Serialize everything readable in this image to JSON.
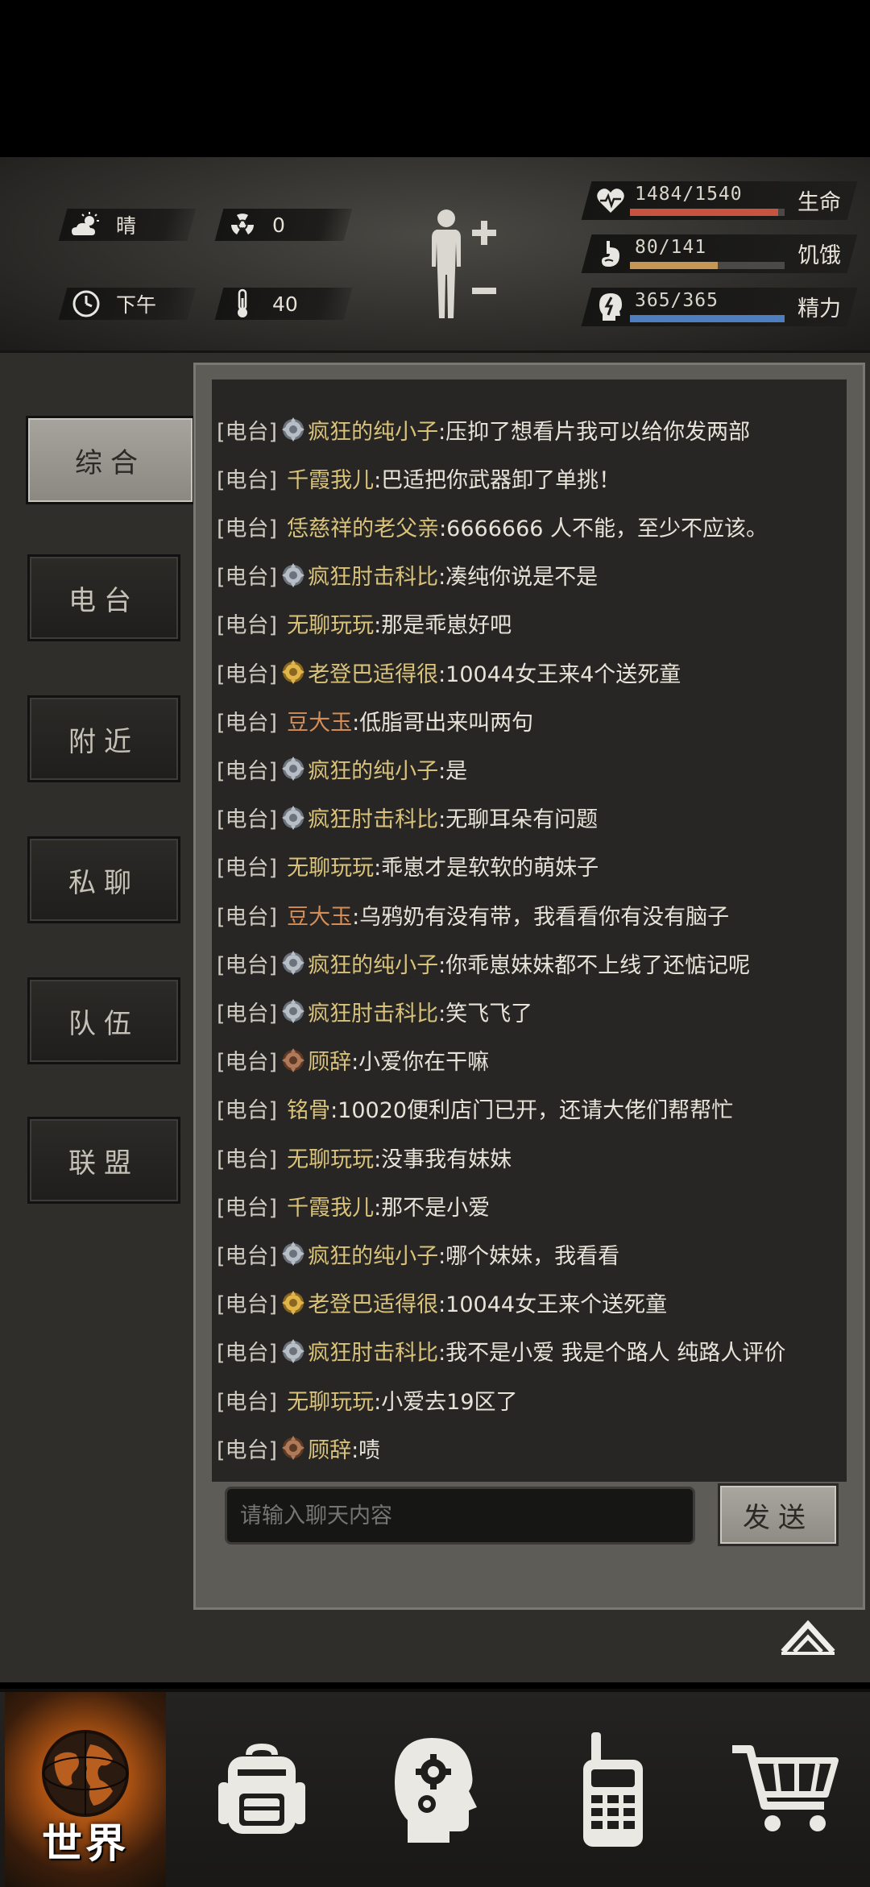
{
  "header": {
    "weather": "晴",
    "radiation": "0",
    "time_of_day": "下午",
    "temperature": "40",
    "stats": [
      {
        "label": "生命",
        "value": "1484/1540",
        "fill": 0.96,
        "color": "#c8533f",
        "icon": "heart-icon"
      },
      {
        "label": "饥饿",
        "value": "80/141",
        "fill": 0.57,
        "color": "#c69655",
        "icon": "stomach-icon"
      },
      {
        "label": "精力",
        "value": "365/365",
        "fill": 1.0,
        "color": "#4d7fc0",
        "icon": "energy-head-icon"
      }
    ]
  },
  "tabs": [
    {
      "label": "综合",
      "active": true
    },
    {
      "label": "电台",
      "active": false
    },
    {
      "label": "附近",
      "active": false
    },
    {
      "label": "私聊",
      "active": false
    },
    {
      "label": "队伍",
      "active": false
    },
    {
      "label": "联盟",
      "active": false
    }
  ],
  "messages": [
    {
      "tag": "[电台]",
      "badge": "silver",
      "name": "疯狂的纯小子",
      "name_color": "yellow",
      "text": ":压抑了想看片我可以给你发两部"
    },
    {
      "tag": "[电台]",
      "badge": "none",
      "name": "千霞我儿",
      "name_color": "yellow",
      "text": ":巴适把你武器卸了单挑！"
    },
    {
      "tag": "[电台]",
      "badge": "none",
      "name": "恁慈祥的老父亲",
      "name_color": "yellow",
      "text": ":6666666 人不能，至少不应该。"
    },
    {
      "tag": "[电台]",
      "badge": "silver",
      "name": "疯狂肘击科比",
      "name_color": "yellow",
      "text": ":凑纯你说是不是"
    },
    {
      "tag": "[电台]",
      "badge": "none",
      "name": "无聊玩玩",
      "name_color": "yellow",
      "text": ":那是乖崽好吧"
    },
    {
      "tag": "[电台]",
      "badge": "gold",
      "name": "老登巴适得很",
      "name_color": "yellow",
      "text": ":10044女王来4个送死童"
    },
    {
      "tag": "[电台]",
      "badge": "none",
      "name": "豆大玉",
      "name_color": "orange",
      "text": ":低脂哥出来叫两句"
    },
    {
      "tag": "[电台]",
      "badge": "silver",
      "name": "疯狂的纯小子",
      "name_color": "yellow",
      "text": ":是"
    },
    {
      "tag": "[电台]",
      "badge": "silver",
      "name": "疯狂肘击科比",
      "name_color": "yellow",
      "text": ":无聊耳朵有问题"
    },
    {
      "tag": "[电台]",
      "badge": "none",
      "name": "无聊玩玩",
      "name_color": "yellow",
      "text": ":乖崽才是软软的萌妹子"
    },
    {
      "tag": "[电台]",
      "badge": "none",
      "name": "豆大玉",
      "name_color": "orange",
      "text": ":乌鸦奶有没有带，我看看你有没有脑子"
    },
    {
      "tag": "[电台]",
      "badge": "silver",
      "name": "疯狂的纯小子",
      "name_color": "yellow",
      "text": ":你乖崽妹妹都不上线了还惦记呢"
    },
    {
      "tag": "[电台]",
      "badge": "silver",
      "name": "疯狂肘击科比",
      "name_color": "yellow",
      "text": ":笑飞飞了"
    },
    {
      "tag": "[电台]",
      "badge": "bronze",
      "name": "顾辞",
      "name_color": "yellow",
      "text": ":小爱你在干嘛"
    },
    {
      "tag": "[电台]",
      "badge": "none",
      "name": "铭骨",
      "name_color": "yellow",
      "text": ":10020便利店门已开，还请大佬们帮帮忙"
    },
    {
      "tag": "[电台]",
      "badge": "none",
      "name": "无聊玩玩",
      "name_color": "yellow",
      "text": ":没事我有妹妹"
    },
    {
      "tag": "[电台]",
      "badge": "none",
      "name": "千霞我儿",
      "name_color": "yellow",
      "text": ":那不是小爱"
    },
    {
      "tag": "[电台]",
      "badge": "silver",
      "name": "疯狂的纯小子",
      "name_color": "yellow",
      "text": ":哪个妹妹，我看看"
    },
    {
      "tag": "[电台]",
      "badge": "gold",
      "name": "老登巴适得很",
      "name_color": "yellow",
      "text": ":10044女王来个送死童"
    },
    {
      "tag": "[电台]",
      "badge": "silver",
      "name": "疯狂肘击科比",
      "name_color": "yellow",
      "text": ":我不是小爱 我是个路人 纯路人评价"
    },
    {
      "tag": "[电台]",
      "badge": "none",
      "name": "无聊玩玩",
      "name_color": "yellow",
      "text": ":小爱去19区了"
    },
    {
      "tag": "[电台]",
      "badge": "bronze",
      "name": "顾辞",
      "name_color": "yellow",
      "text": ":啧"
    }
  ],
  "input": {
    "placeholder": "请输入聊天内容",
    "value": ""
  },
  "send_label": "发送",
  "nav": {
    "world_label": "世界",
    "items": [
      "globe-icon",
      "backpack-icon",
      "skills-head-icon",
      "radio-icon",
      "cart-icon"
    ]
  }
}
